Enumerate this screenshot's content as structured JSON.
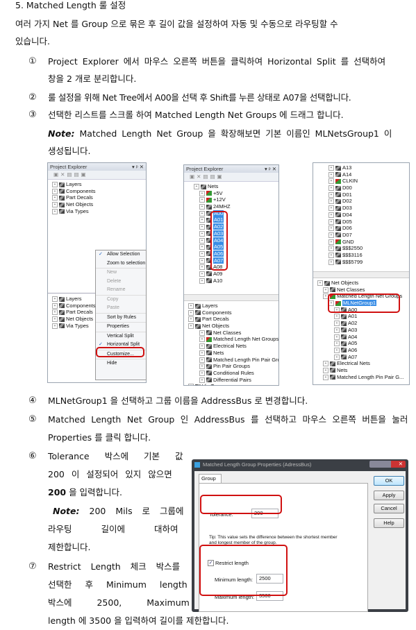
{
  "heading": "5.   Matched Length 룰 설정",
  "intro": [
    "여러 가지 Net 를 Group 으로 묶은 후 길이 값을 설정하여 자동 및 수동으로 라우팅할 수",
    "있습니다."
  ],
  "steps": [
    {
      "num": "①",
      "lines": [
        "Project Explorer 에서 마우스 오른쪽 버튼을 클릭하여 Horizontal Split 를 선택하여",
        "창을 2 개로 분리합니다."
      ]
    },
    {
      "num": "②",
      "lines": [
        "룰 설정을 위해 Net Tree에서 A00을 선택 후 Shift를 누른 상태로 A07을 선택합니다."
      ]
    },
    {
      "num": "③",
      "lines": [
        "선택한 리스트를 스크롤 하여 Matched Length Net Groups 에 드래그 합니다."
      ]
    },
    {
      "num": "④",
      "lines": [
        "MLNetGroup1 을 선택하고 그룹 이름을 AddressBus 로 변경합니다."
      ]
    },
    {
      "num": "⑤",
      "lines": [
        "Matched Length Net Group 인 AddressBus 를 선택하고 마우스 오른쪽 버튼을 눌러",
        "Properties 를 클릭 합니다."
      ]
    },
    {
      "num": "⑥",
      "lines": [
        "Tolerance 박스에 기본 값",
        "200 이 설정되어 있지 않으면",
        "200",
        "을 입력합니다."
      ]
    },
    {
      "num": "⑦",
      "lines": [
        "Restrict Length 체크 박스를",
        "선택한 후 Minimum length",
        "박스에 2500, Maximum",
        "length 에 3500 을 입력하여 길이를 제한합니다."
      ]
    }
  ],
  "note3": {
    "label": "Note:",
    "text": "Matched Length Net Group 을 확장해보면 기본 이름인 MLNetsGroup1 이",
    "text2": "생성됩니다."
  },
  "note6": {
    "label": "Note:",
    "text": "200 Mils 로 그룹에",
    "text2": "라우팅 길이에 대하여",
    "text3": "제한합니다."
  },
  "shot1": {
    "title": "Project Explorer",
    "controls": "▾ ᵖ ✕",
    "tree": [
      "Layers",
      "Components",
      "Part Decals",
      "Net Objects",
      "Via Types"
    ],
    "menu": [
      {
        "label": "Allow Selection",
        "checked": true
      },
      {
        "label": "Zoom to selection"
      },
      {
        "label": "New",
        "disabled": true
      },
      {
        "label": "Delete",
        "disabled": true
      },
      {
        "label": "Rename",
        "disabled": true
      },
      {
        "label": "Copy",
        "disabled": true
      },
      {
        "label": "Paste",
        "disabled": true
      },
      {
        "label": "Sort by Rules"
      },
      {
        "label": "Properties"
      },
      {
        "label": "Vertical Split"
      },
      {
        "label": "Horizontal Split",
        "checked": true
      },
      {
        "label": "Customize..."
      },
      {
        "label": "Hide"
      }
    ]
  },
  "shot2": {
    "title": "Project Explorer",
    "controls": "▾ ᵖ ✕",
    "top": [
      "Nets",
      "+5V",
      "+12V",
      "24MHZ",
      "A00",
      "A01",
      "A02",
      "A03",
      "A04",
      "A05",
      "A06",
      "A07",
      "A08",
      "A09",
      "A10"
    ],
    "bottom": [
      "Layers",
      "Components",
      "Part Decals",
      "Net Objects",
      "Net Classes",
      "Matched Length Net Groups",
      "Electrical Nets",
      "Nets",
      "Matched Length Pin Pair Groups",
      "Pin Pair Groups",
      "Conditional Rules",
      "Differential Pairs",
      "Via Types"
    ]
  },
  "shot3": {
    "top": [
      "A13",
      "A14",
      "CLKIN",
      "D00",
      "D01",
      "D02",
      "D03",
      "D04",
      "D05",
      "D06",
      "D07",
      "GND",
      "$$$2550",
      "$$$3116",
      "$$$5799"
    ],
    "bottom": [
      "Net Objects",
      "Net Classes",
      "Matched Length Net Groups",
      "MLNetGroup1",
      "A00",
      "A01",
      "A02",
      "A03",
      "A04",
      "A05",
      "A06",
      "A07",
      "Electrical Nets",
      "Nets",
      "Matched Length Pin Pair G..."
    ]
  },
  "dialog": {
    "title": "Matched Length Group Properties (AdressBus)",
    "tab": "Group",
    "tolerance_label": "Tolerance:",
    "tolerance": "200",
    "tip": [
      "Tip: This value sets the difference between the shortest member",
      "and longest member of the group."
    ],
    "restrict_label": "Restrict length",
    "restrict_checked": true,
    "min_label": "Minimum length:",
    "min": "2500",
    "max_label": "Maximum length:",
    "max": "3500",
    "ok": "OK",
    "apply": "Apply",
    "cancel": "Cancel",
    "help": "Help"
  },
  "colors": {
    "highlight": "#d01010",
    "selection": "#3a8ee6"
  }
}
